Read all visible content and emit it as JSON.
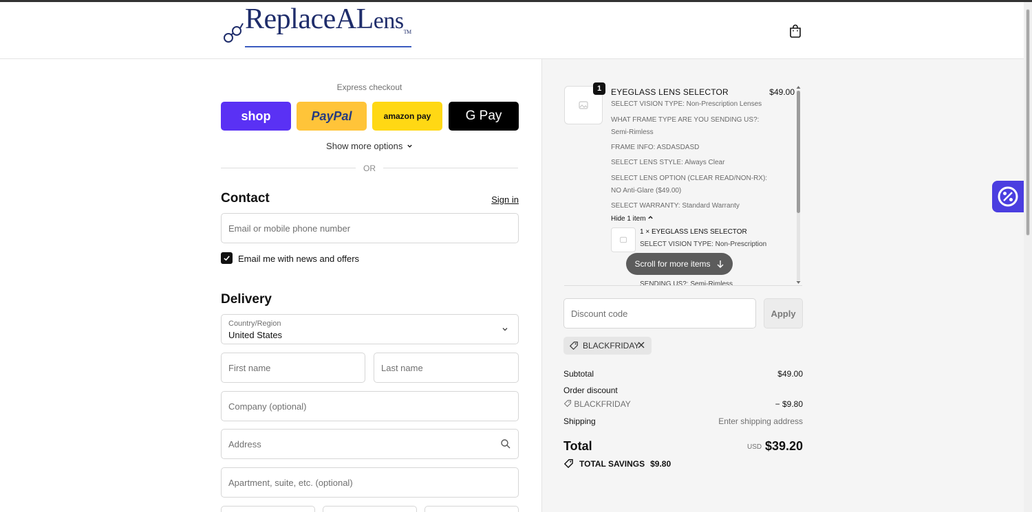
{
  "brand": {
    "logo_text_1": "Replace",
    "logo_text_2": "A",
    "logo_text_3": "L",
    "logo_text_4": "ens",
    "logo_tm": "TM"
  },
  "express": {
    "title": "Express checkout",
    "shop_label": "shop",
    "paypal_label": "PayPal",
    "amazon_label": "amazon pay",
    "gpay_label": "G Pay",
    "show_more": "Show more options",
    "or": "OR"
  },
  "contact": {
    "heading": "Contact",
    "sign_in": "Sign in",
    "email_placeholder": "Email or mobile phone number",
    "news_label": "Email me with news and offers",
    "news_checked": true
  },
  "delivery": {
    "heading": "Delivery",
    "country_label": "Country/Region",
    "country_value": "United States",
    "first_name": "First name",
    "last_name": "Last name",
    "company": "Company (optional)",
    "address": "Address",
    "apartment": "Apartment, suite, etc. (optional)"
  },
  "cart": {
    "quantity": "1",
    "title": "EYEGLASS LENS SELECTOR",
    "price": "$49.00",
    "lines": [
      "SELECT VISION TYPE: Non-Prescription Lenses",
      "WHAT FRAME TYPE ARE YOU SENDING US?:",
      "Semi-Rimless",
      "FRAME INFO: ASDASDASD",
      "SELECT LENS STYLE: Always Clear",
      "SELECT LENS OPTION (CLEAR READ/NON-RX):",
      "NO Anti-Glare ($49.00)",
      "SELECT WARRANTY: Standard Warranty"
    ],
    "hide_items": "Hide 1 item",
    "sub_title": "1 × EYEGLASS LENS SELECTOR",
    "sub_line_1": "SELECT VISION TYPE: Non-Prescription",
    "sub_line_2": "SENDING US?: Semi-Rimless",
    "scroll_hint": "Scroll for more items"
  },
  "discount": {
    "placeholder": "Discount code",
    "apply": "Apply",
    "applied_code": "BLACKFRIDAY"
  },
  "summary": {
    "subtotal_label": "Subtotal",
    "subtotal_value": "$49.00",
    "order_discount_label": "Order discount",
    "discount_code": "BLACKFRIDAY",
    "discount_value": "− $9.80",
    "shipping_label": "Shipping",
    "shipping_value": "Enter shipping address",
    "total_label": "Total",
    "currency": "USD",
    "total_value": "$39.20",
    "savings_label": "TOTAL SAVINGS",
    "savings_value": "$9.80"
  },
  "colors": {
    "shop": "#5a31f4",
    "paypal": "#ffc439",
    "amazon": "#ffd814",
    "gpay": "#000000",
    "promo_widget": "#4b3ee0"
  }
}
